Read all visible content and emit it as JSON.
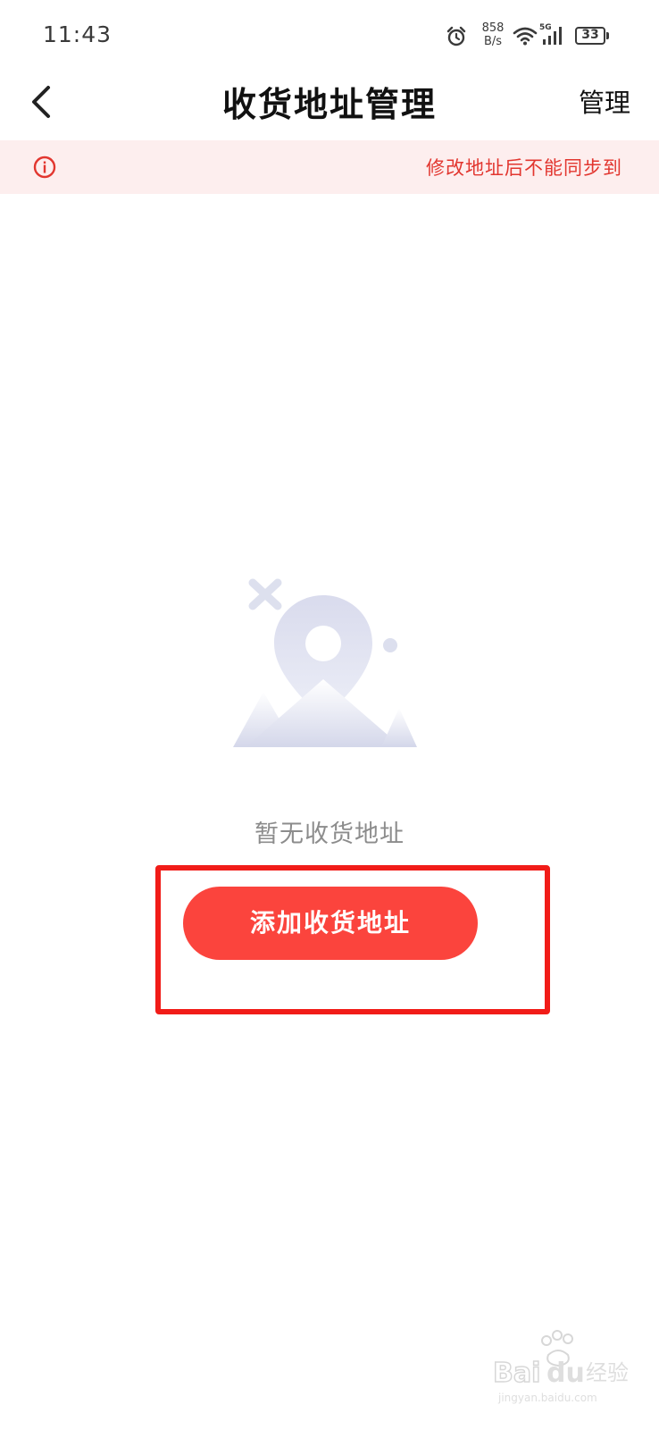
{
  "status_bar": {
    "time": "11:43",
    "net_speed_value": "858",
    "net_speed_unit": "B/s",
    "network_type": "5G",
    "battery": "33",
    "battery_level": 0.33
  },
  "nav": {
    "title": "收货地址管理",
    "manage_label": "管理"
  },
  "notice": {
    "text": "修改地址后不能同步到"
  },
  "empty_state": {
    "message": "暂无收货地址",
    "add_button_label": "添加收货地址"
  },
  "watermark": {
    "text": "Baidu经验",
    "url": "jingyan.baidu.com"
  },
  "colors": {
    "accent": "#fb443d",
    "highlight": "#f11c18",
    "notice_bg": "#fdeeee",
    "notice_text": "#e2362f"
  }
}
